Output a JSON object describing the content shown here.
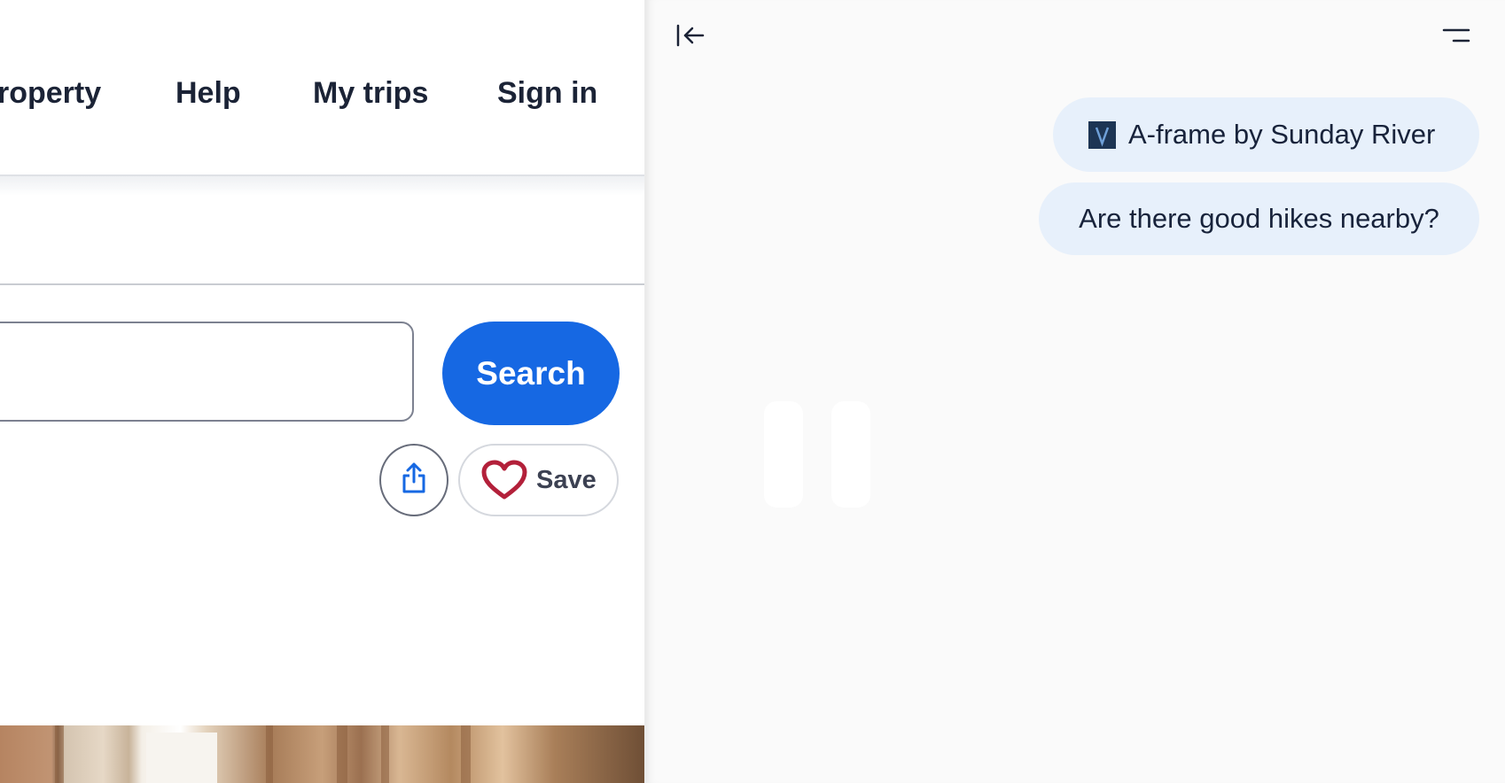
{
  "nav": {
    "links": [
      "roperty",
      "Help",
      "My trips",
      "Sign in"
    ]
  },
  "search": {
    "value": "",
    "button_label": "Search"
  },
  "actions": {
    "save_label": "Save",
    "share_icon": "share-icon",
    "heart_icon": "heart-icon"
  },
  "assistant": {
    "collapse_icon": "collapse-left-icon",
    "menu_icon": "menu-icon",
    "chips": [
      {
        "label": "A-frame by Sunday River",
        "icon": "property-thumbnail"
      },
      {
        "label": "Are there good hikes nearby?"
      }
    ],
    "status_icon": "pause-icon"
  },
  "colors": {
    "primary": "#1668e3",
    "heart": "#b3203a",
    "chip_bg": "#e7f0fb",
    "text": "#1b2336"
  }
}
